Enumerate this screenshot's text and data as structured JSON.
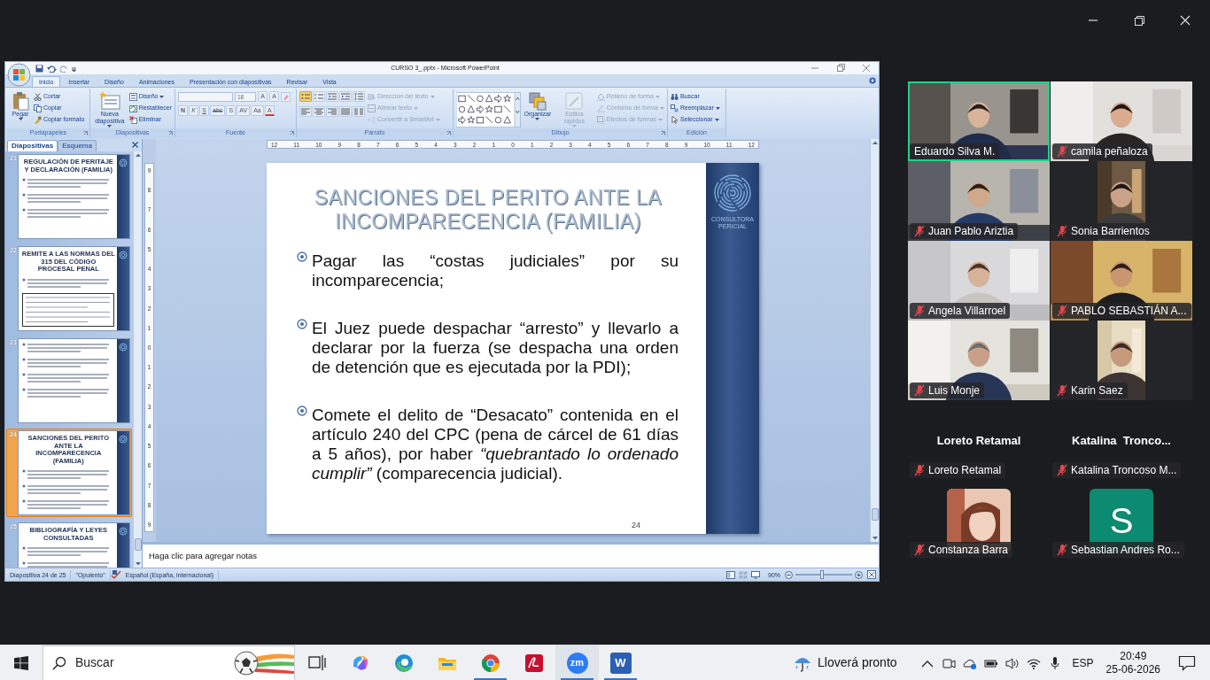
{
  "powerpoint": {
    "title": "CURSO 3_.pptx - Microsoft PowerPoint",
    "tabs": [
      {
        "label": "Inicio",
        "selected": true
      },
      {
        "label": "Insertar",
        "selected": false
      },
      {
        "label": "Diseño",
        "selected": false
      },
      {
        "label": "Animaciones",
        "selected": false
      },
      {
        "label": "Presentación con diapositivas",
        "selected": false
      },
      {
        "label": "Revisar",
        "selected": false
      },
      {
        "label": "Vista",
        "selected": false
      }
    ],
    "ribbon": [
      {
        "kind": "clipboard",
        "label": "Portapapeles",
        "large": [
          {
            "kind": "paste",
            "label": "Pegar",
            "disabled": false,
            "dropdown": true
          }
        ],
        "small": [
          {
            "kind": "cut",
            "label": "Cortar",
            "disabled": false,
            "dropdown": false
          },
          {
            "kind": "copy",
            "label": "Copiar",
            "disabled": false,
            "dropdown": false
          },
          {
            "kind": "brush",
            "label": "Copiar formato",
            "disabled": false,
            "dropdown": false
          }
        ]
      },
      {
        "kind": "slides",
        "label": "Diapositivas",
        "large": [
          {
            "kind": "newslide",
            "label": "Nueva diapositiva",
            "disabled": false,
            "dropdown": true
          }
        ],
        "small": [
          {
            "kind": "layout",
            "label": "Diseño",
            "disabled": false,
            "dropdown": true
          },
          {
            "kind": "reset",
            "label": "Restablecer",
            "disabled": false,
            "dropdown": false
          },
          {
            "kind": "delete",
            "label": "Eliminar",
            "disabled": false,
            "dropdown": false
          }
        ]
      },
      {
        "kind": "font",
        "label": "Fuente",
        "font_size": "18",
        "size_buttons": [
          "A",
          "A"
        ],
        "format_buttons": [
          "N",
          "K",
          "S",
          "abc",
          "S",
          "AV",
          "Aa",
          "A"
        ]
      },
      {
        "kind": "paragraph",
        "label": "Párrafo",
        "list_buttons": [
          {
            "kind": "bullets",
            "selected": true
          },
          {
            "kind": "numbering",
            "selected": false
          },
          {
            "kind": "outdent",
            "selected": false
          },
          {
            "kind": "indent",
            "selected": false
          },
          {
            "kind": "spacing",
            "selected": false
          }
        ],
        "align_buttons": [
          {
            "kind": "left",
            "selected": false
          },
          {
            "kind": "center",
            "selected": false
          },
          {
            "kind": "right",
            "selected": false
          },
          {
            "kind": "justify",
            "selected": false
          },
          {
            "kind": "columns",
            "selected": false
          }
        ],
        "small": [
          {
            "kind": "textdir",
            "label": "Dirección del texto",
            "disabled": true,
            "dropdown": true
          },
          {
            "kind": "aligntext",
            "label": "Alinear texto",
            "disabled": true,
            "dropdown": true
          },
          {
            "kind": "smartart",
            "label": "Convertir a SmartArt",
            "disabled": true,
            "dropdown": true
          }
        ]
      },
      {
        "kind": "drawing",
        "label": "Dibujo",
        "large": [
          {
            "kind": "arrange",
            "label": "Organizar",
            "disabled": false,
            "dropdown": true
          },
          {
            "kind": "styles",
            "label": "Estilos rápidos",
            "disabled": true,
            "dropdown": true
          }
        ],
        "small": [
          {
            "kind": "fill",
            "label": "Relleno de forma",
            "disabled": true,
            "dropdown": true
          },
          {
            "kind": "outline",
            "label": "Contorno de forma",
            "disabled": true,
            "dropdown": true
          },
          {
            "kind": "effects",
            "label": "Efectos de formas",
            "disabled": true,
            "dropdown": true
          }
        ]
      },
      {
        "kind": "editing",
        "label": "Edición",
        "small": [
          {
            "kind": "find",
            "label": "Buscar",
            "disabled": false,
            "dropdown": false
          },
          {
            "kind": "replace",
            "label": "Reemplazar",
            "disabled": false,
            "dropdown": true
          },
          {
            "kind": "select",
            "label": "Seleccionar",
            "disabled": false,
            "dropdown": true
          }
        ]
      }
    ],
    "panel_tabs": [
      {
        "label": "Diapositivas",
        "selected": true
      },
      {
        "label": "Esquema",
        "selected": false
      }
    ],
    "thumbnails": [
      {
        "number": "21",
        "selected": false,
        "title": "REGULACIÓN DE PERITAJE Y DECLARACIÓN (FAMILIA)",
        "blocks": [
          {
            "kind": "lines"
          },
          {
            "kind": "lines"
          },
          {
            "kind": "lines"
          }
        ]
      },
      {
        "number": "22",
        "selected": false,
        "title": "REMITE A LAS NORMAS DEL 315 DEL CÓDIGO PROCESAL PENAL",
        "blocks": [
          {
            "kind": "lines"
          },
          {
            "kind": "document"
          }
        ]
      },
      {
        "number": "23",
        "selected": false,
        "blocks": [
          {
            "kind": "lines"
          },
          {
            "kind": "lines"
          },
          {
            "kind": "lines"
          },
          {
            "kind": "lines"
          }
        ]
      },
      {
        "number": "24",
        "selected": true,
        "title": "SANCIONES DEL PERITO ANTE LA INCOMPARECENCIA (FAMILIA)",
        "blocks": [
          {
            "kind": "lines"
          },
          {
            "kind": "lines"
          },
          {
            "kind": "lines"
          }
        ]
      },
      {
        "number": "25",
        "selected": false,
        "title": "BIBLIOGRAFÍA Y LEYES CONSULTADAS",
        "blocks": [
          {
            "kind": "lines"
          },
          {
            "kind": "lines"
          }
        ]
      }
    ],
    "ruler": {
      "horizontal": [
        "12",
        "11",
        "10",
        "9",
        "8",
        "7",
        "6",
        "5",
        "4",
        "3",
        "2",
        "1",
        "0",
        "1",
        "2",
        "3",
        "4",
        "5",
        "6",
        "7",
        "8",
        "9",
        "10",
        "11",
        "12"
      ],
      "vertical": [
        "9",
        "8",
        "7",
        "6",
        "5",
        "4",
        "3",
        "2",
        "1",
        "0",
        "1",
        "2",
        "3",
        "4",
        "5",
        "6",
        "7",
        "8",
        "9"
      ]
    },
    "slide": {
      "title": "SANCIONES DEL PERITO ANTE LA INCOMPARECENCIA (FAMILIA)",
      "logo_text": "CONSULTORA PERICIAL",
      "page_number": "24",
      "blocks": [
        {
          "kind": "bullet",
          "text": "Pagar las “costas judiciales” por su incomparecencia;"
        },
        {
          "kind": "bullet",
          "text": "El Juez puede despachar “arresto” y llevarlo a declarar por la fuerza (se despacha una orden de detención que es ejecutada por la PDI);"
        },
        {
          "kind": "bullet",
          "text": "Comete el delito de “Desacato” contenida en el artículo 240 del CPC (pena de cárcel de 61 días a 5 años), por haber *“quebrantado lo ordenado cumplir”* (comparecencia judicial)."
        }
      ]
    },
    "notes": {
      "placeholder": "Haga clic para agregar notas"
    },
    "status_bar": {
      "slide": "Diapositiva 24 de 25",
      "theme": "\"Opulento\"",
      "language": "Español (España, internacional)",
      "zoom": "90%",
      "zoom_slider": {
        "level": 0.47
      }
    }
  },
  "participants": [
    {
      "name": "Eduardo Silva M.",
      "kind": "video",
      "muted": false,
      "speaking": true
    },
    {
      "name": "camila peñaloza",
      "kind": "video",
      "muted": true,
      "speaking": false
    },
    {
      "name": "Juan Pablo Ariztia",
      "kind": "video",
      "muted": true,
      "speaking": false
    },
    {
      "name": "Sonia Barrientos",
      "kind": "portrait",
      "muted": true,
      "speaking": false
    },
    {
      "name": "Angela Villarroel",
      "kind": "video",
      "muted": true,
      "speaking": false
    },
    {
      "name": "PABLO SEBASTIÁN A...",
      "kind": "video",
      "muted": true,
      "speaking": false
    },
    {
      "name": "Luis Monje",
      "kind": "video",
      "muted": true,
      "speaking": false
    },
    {
      "name": "Karin Saez",
      "kind": "portrait",
      "muted": true,
      "speaking": false
    },
    {
      "name": "Loreto Retamal",
      "kind": "name",
      "display_name": "Loreto Retamal",
      "muted": true,
      "speaking": false
    },
    {
      "name": "Katalina Troncoso M...",
      "kind": "name",
      "display_name": "Katalina  Tronco...",
      "muted": true,
      "speaking": false
    },
    {
      "name": "Constanza Barra",
      "muted": true,
      "speaking": false
    },
    {
      "name": "Sebastian Andres Ro...",
      "kind": "initial",
      "initial": "S",
      "muted": true,
      "speaking": false
    }
  ],
  "taskbar": {
    "search": {
      "placeholder": "Buscar"
    },
    "apps": [
      {
        "kind": "taskview",
        "running": false,
        "active": false
      },
      {
        "kind": "copilot",
        "running": false,
        "active": false
      },
      {
        "kind": "edge",
        "running": false,
        "active": false
      },
      {
        "kind": "explorer",
        "running": false,
        "active": false
      },
      {
        "kind": "chrome",
        "running": true,
        "active": false
      },
      {
        "kind": "acrobat",
        "running": false,
        "active": false
      },
      {
        "kind": "zoom",
        "glyph": "zm",
        "running": true,
        "active": true
      },
      {
        "kind": "word",
        "glyph": "W",
        "running": true,
        "active": false
      }
    ],
    "weather": "Lloverá pronto",
    "language": "ESP",
    "time": "20:49",
    "date": "25-06-2026"
  }
}
